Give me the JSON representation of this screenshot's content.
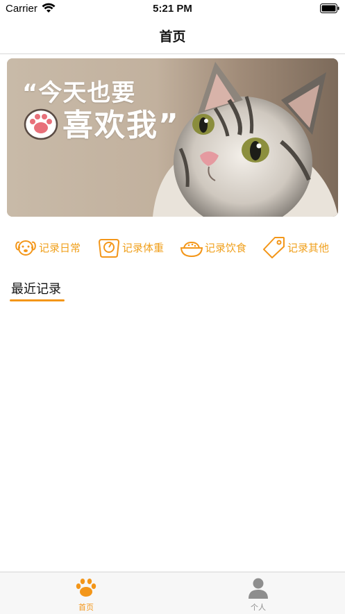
{
  "status_bar": {
    "carrier": "Carrier",
    "time": "5:21 PM"
  },
  "nav": {
    "title": "首页"
  },
  "banner": {
    "line1": "“今天也要",
    "line2": "喜欢我”"
  },
  "shortcuts": [
    {
      "label": "记录日常",
      "icon": "dog-icon"
    },
    {
      "label": "记录体重",
      "icon": "scale-icon"
    },
    {
      "label": "记录饮食",
      "icon": "food-bowl-icon"
    },
    {
      "label": "记录其他",
      "icon": "tag-icon"
    }
  ],
  "recent": {
    "title": "最近记录"
  },
  "tabbar": {
    "tabs": [
      {
        "label": "首页",
        "icon": "paw-icon",
        "active": true
      },
      {
        "label": "个人",
        "icon": "person-icon",
        "active": false
      }
    ]
  },
  "colors": {
    "accent": "#f39619",
    "inactive": "#8e8e8e"
  }
}
